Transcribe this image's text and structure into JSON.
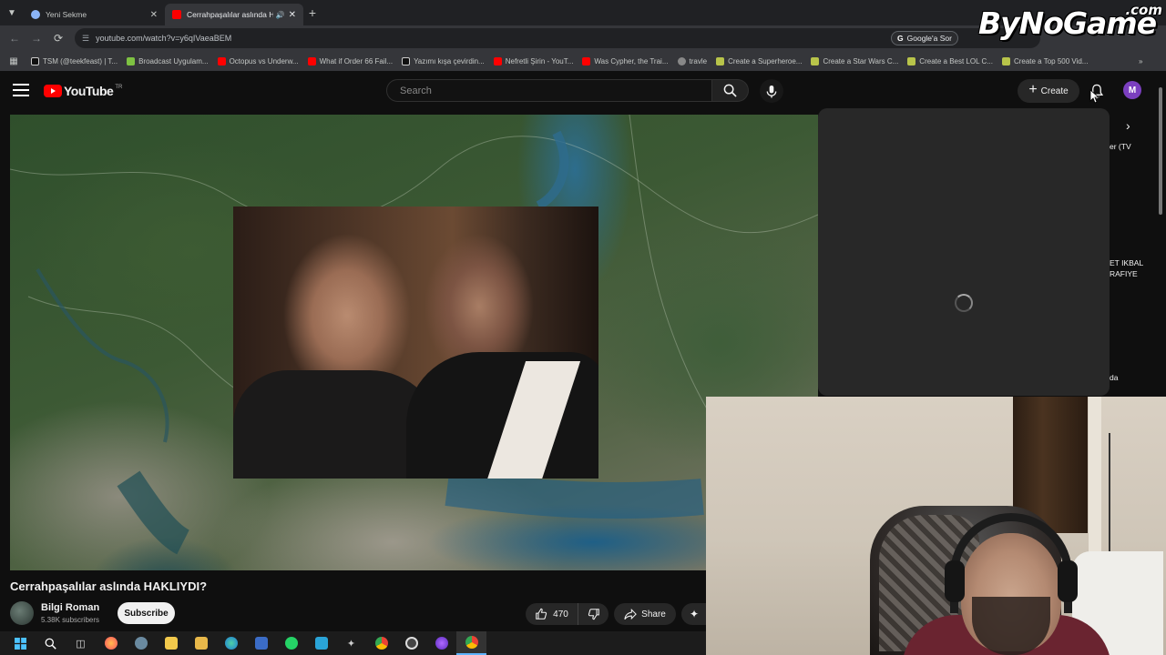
{
  "browser": {
    "tabs": [
      {
        "title": "Yeni Sekme",
        "active": false
      },
      {
        "title": "Cerrahpaşalılar aslında HA",
        "active": true
      }
    ],
    "url": "youtube.com/watch?v=y6qIVaeaBEM",
    "google_lens_label": "Google'a Sor",
    "bookmarks": [
      "TSM (@teekfeast) | T...",
      "Broadcast Uygulam...",
      "Octopus vs Underw...",
      "What if Order 66 Fail...",
      "Yazımı kışa çevirdin...",
      "Nefretli Şirin - YouT...",
      "Was Cypher, the Trai...",
      "travle",
      "Create a Superheroe...",
      "Create a Star Wars C...",
      "Create a Best LOL C...",
      "Create a Top 500 Vid..."
    ]
  },
  "watermark": {
    "main": "ByNoGame",
    "suffix": ".com"
  },
  "youtube": {
    "logo_text": "YouTube",
    "country_code": "TR",
    "search_placeholder": "Search",
    "create_label": "Create",
    "avatar_letter": "M"
  },
  "video": {
    "title": "Cerrahpaşalılar aslında HAKLIYDI?",
    "channel_name": "Bilgi Roman",
    "subscribers": "5.38K subscribers",
    "subscribe_label": "Subscribe",
    "likes": "470",
    "share_label": "Share"
  },
  "sidebar_peek": {
    "line1": "er (TV",
    "line2": "ET IKBAL",
    "line3": "RAFIYE",
    "line4": "da"
  },
  "colors": {
    "yt_red": "#ff0000",
    "panel_bg": "#282828",
    "page_bg": "#0f0f0f"
  },
  "taskbar_icons": [
    "windows-icon",
    "search-icon",
    "task-view-icon",
    "firefox-icon",
    "app-icon",
    "folder-icon",
    "edge-icon",
    "app-icon",
    "whatsapp-icon",
    "app-icon",
    "app-icon",
    "chrome-icon",
    "app-icon",
    "app-icon",
    "chrome-icon"
  ]
}
